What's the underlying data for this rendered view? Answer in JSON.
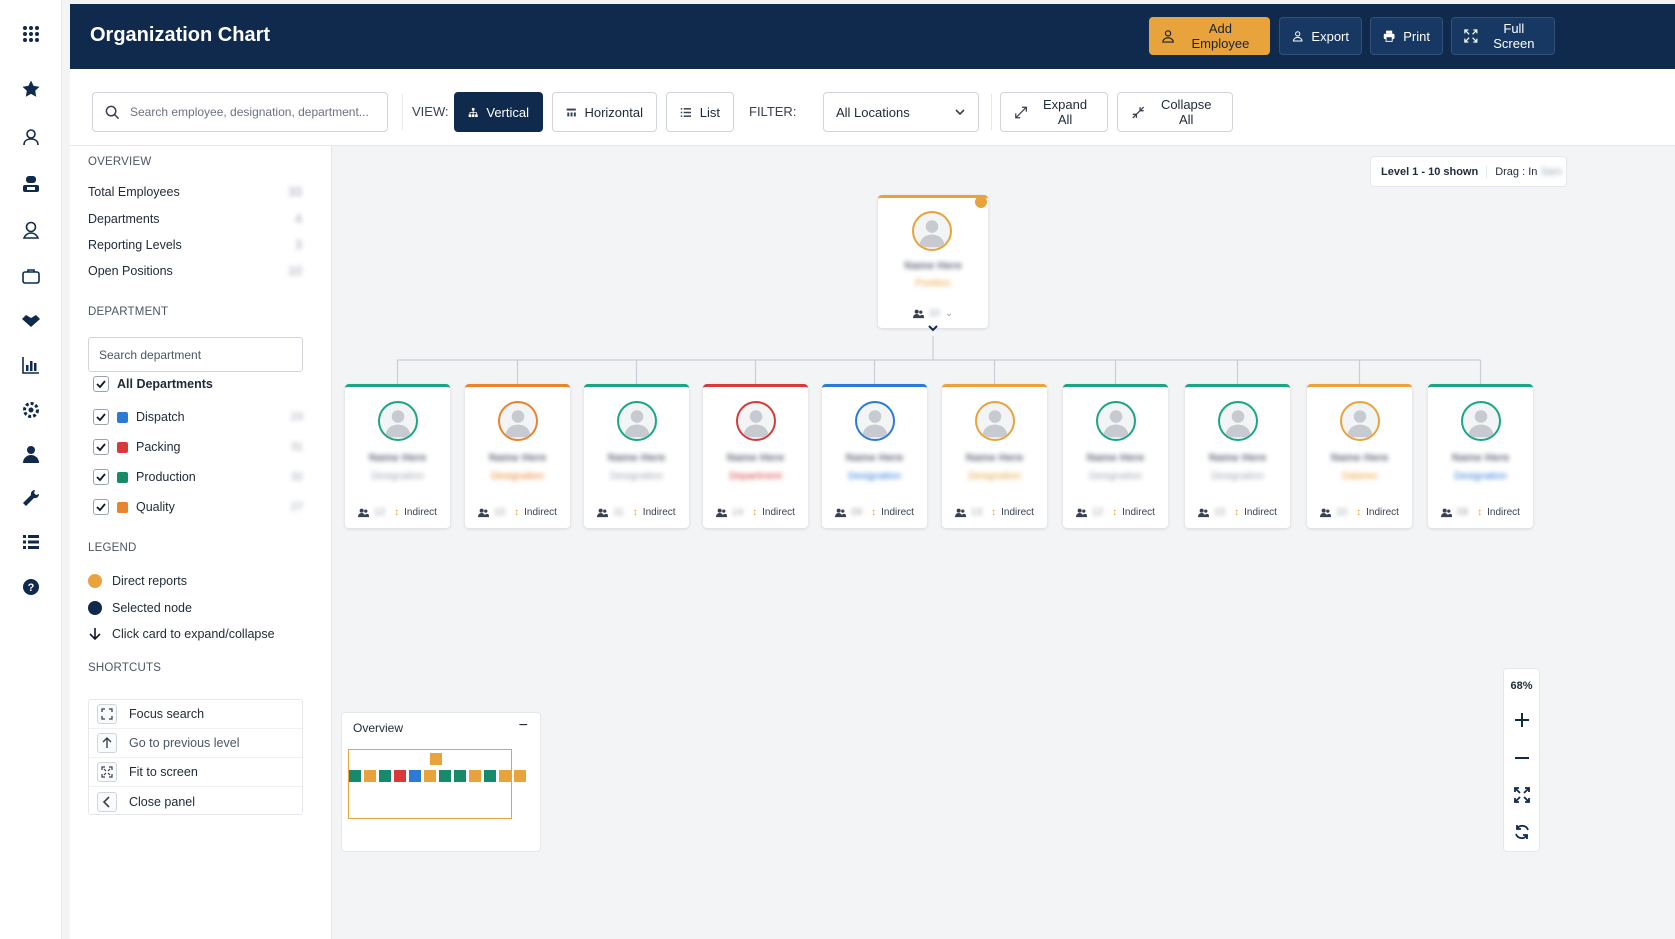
{
  "app": {
    "title": "Organization Chart",
    "accent_color": "#e8a33c",
    "navy_color": "#0f2a4d"
  },
  "rail": {
    "icons": [
      "apps-grid-icon",
      "star-icon",
      "users-icon",
      "org-chart-icon",
      "contact-icon",
      "briefcase-icon",
      "handshake-icon",
      "bar-chart-icon",
      "settings-icon",
      "person-icon",
      "wrench-icon",
      "list-icon",
      "help-icon"
    ]
  },
  "header_actions": {
    "add_employee": "Add Employee",
    "export": "Export",
    "print": "Print",
    "full_screen": "Full Screen"
  },
  "toolbar": {
    "search_placeholder": "Search employee, designation, department...",
    "view_label": "VIEW:",
    "view_vertical": "Vertical",
    "view_horizontal": "Horizontal",
    "view_list": "List",
    "filter_label": "FILTER:",
    "filter_value": "All Locations",
    "expand_all": "Expand All",
    "collapse_all": "Collapse All"
  },
  "overview": {
    "title": "OVERVIEW",
    "rows": [
      {
        "label": "Total Employees",
        "value": "33"
      },
      {
        "label": "Departments",
        "value": "4"
      },
      {
        "label": "Reporting Levels",
        "value": "3"
      },
      {
        "label": "Open Positions",
        "value": "10"
      }
    ]
  },
  "department": {
    "title": "DEPARTMENT",
    "search_placeholder": "Search department",
    "all_label": "All Departments",
    "items": [
      {
        "label": "Dispatch",
        "color": "#2b7bd6",
        "count": "23"
      },
      {
        "label": "Packing",
        "color": "#d83a3a",
        "count": "31"
      },
      {
        "label": "Production",
        "color": "#168a6a",
        "count": "32"
      },
      {
        "label": "Quality",
        "color": "#e8842c",
        "count": "27"
      }
    ]
  },
  "legend": {
    "title": "LEGEND",
    "direct": "Direct reports",
    "selected": "Selected node",
    "click": "Click card to expand/collapse"
  },
  "shortcuts": {
    "title": "SHORTCUTS",
    "items": [
      "Focus search",
      "Go to previous level",
      "Fit to screen",
      "Close panel"
    ]
  },
  "canvas": {
    "level_text": "Level 1 - 10 shown",
    "drag_label": "Drag :",
    "drag_value": "In",
    "drag_blur": "3am"
  },
  "root_card": {
    "name": "Name Here",
    "role": "Position",
    "count": "10",
    "color": "#e8a33c"
  },
  "cards": [
    {
      "name": "Name Here",
      "role": "Designation",
      "count": "12",
      "indirect": "Indirect",
      "color": "#1aa683",
      "role_color": "#9ca3af"
    },
    {
      "name": "Name Here",
      "role": "Designation",
      "count": "10",
      "indirect": "Indirect",
      "color": "#e8842c",
      "role_color": "#e8842c"
    },
    {
      "name": "Name Here",
      "role": "Designation",
      "count": "11",
      "indirect": "Indirect",
      "color": "#1aa683",
      "role_color": "#9ca3af"
    },
    {
      "name": "Name Here",
      "role": "Department",
      "count": "14",
      "indirect": "Indirect",
      "color": "#d83a3a",
      "role_color": "#d83a3a"
    },
    {
      "name": "Name Here",
      "role": "Designation",
      "count": "09",
      "indirect": "Indirect",
      "color": "#2b7bd6",
      "role_color": "#2b7bd6"
    },
    {
      "name": "Name Here",
      "role": "Designation",
      "count": "13",
      "indirect": "Indirect",
      "color": "#e8a33c",
      "role_color": "#e8a33c"
    },
    {
      "name": "Name Here",
      "role": "Designation",
      "count": "12",
      "indirect": "Indirect",
      "color": "#1aa683",
      "role_color": "#9ca3af"
    },
    {
      "name": "Name Here",
      "role": "Designation",
      "count": "15",
      "indirect": "Indirect",
      "color": "#1aa683",
      "role_color": "#9ca3af"
    },
    {
      "name": "Name Here",
      "role": "Salaries",
      "count": "10",
      "indirect": "Indirect",
      "color": "#e8a33c",
      "role_color": "#e8a33c"
    },
    {
      "name": "Name Here",
      "role": "Designation",
      "count": "08",
      "indirect": "Indirect",
      "color": "#1aa683",
      "role_color": "#2b7bd6"
    }
  ],
  "minimap": {
    "title": "Overview",
    "collapse": "−",
    "colors": [
      "#168a6a",
      "#e8a33c",
      "#168a6a",
      "#d83a3a",
      "#2b7bd6",
      "#e8a33c",
      "#168a6a",
      "#168a6a",
      "#e8a33c",
      "#168a6a",
      "#e8a33c",
      "#e8a33c"
    ],
    "root_color": "#e8a33c"
  },
  "zoom": {
    "percent": "68%"
  }
}
